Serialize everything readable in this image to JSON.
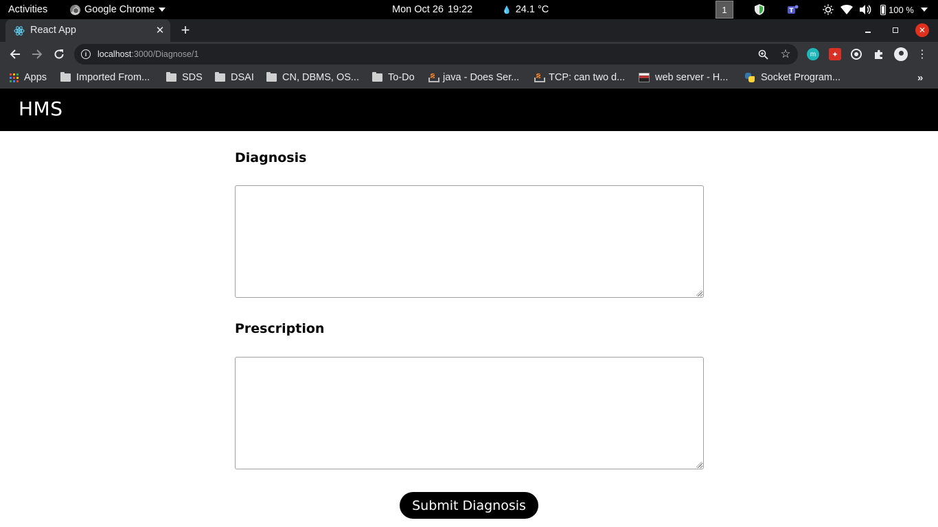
{
  "system_bar": {
    "activities": "Activities",
    "app_name": "Google Chrome",
    "date": "Mon Oct 26",
    "time": "19:22",
    "weather": "24.1 °C",
    "workspace": "1",
    "battery": "100 %"
  },
  "browser": {
    "tab_title": "React App",
    "url_host": "localhost",
    "url_rest": ":3000/Diagnose/1",
    "bookmarks": [
      {
        "label": "Apps",
        "icon": "apps-grid-icon"
      },
      {
        "label": "Imported From...",
        "icon": "folder-icon"
      },
      {
        "label": "SDS",
        "icon": "folder-icon"
      },
      {
        "label": "DSAI",
        "icon": "folder-icon"
      },
      {
        "label": "CN, DBMS, OS...",
        "icon": "folder-icon"
      },
      {
        "label": "To-Do",
        "icon": "folder-icon"
      },
      {
        "label": "java - Does Ser...",
        "icon": "stackoverflow-icon"
      },
      {
        "label": "TCP: can two d...",
        "icon": "stackoverflow-icon"
      },
      {
        "label": "web server - H...",
        "icon": "webserver-icon"
      },
      {
        "label": "Socket Program...",
        "icon": "python-icon"
      }
    ]
  },
  "app": {
    "brand": "HMS",
    "form": {
      "diagnosis_label": "Diagnosis",
      "diagnosis_value": "",
      "prescription_label": "Prescription",
      "prescription_value": "",
      "submit_label": "Submit Diagnosis"
    }
  },
  "colors": {
    "header_bg": "#000000",
    "button_bg": "#000000",
    "chrome_dark": "#35363a"
  }
}
